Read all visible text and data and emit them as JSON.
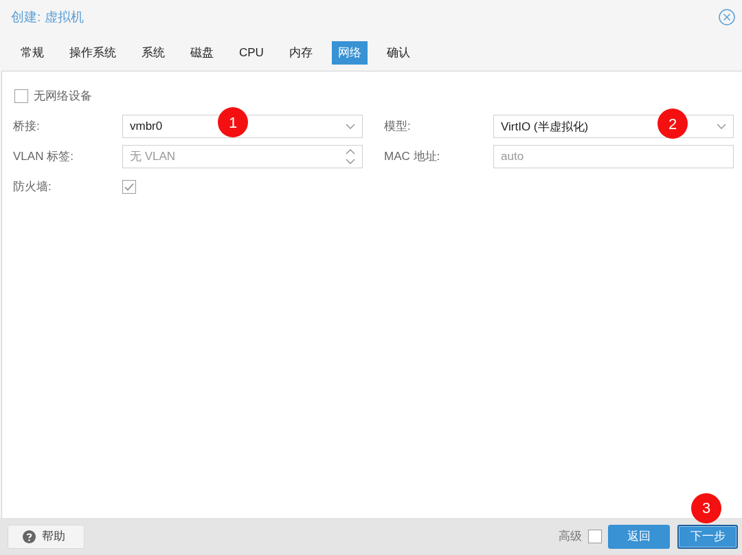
{
  "window": {
    "title": "创建: 虚拟机"
  },
  "tabs": [
    {
      "label": "常规",
      "selected": false
    },
    {
      "label": "操作系统",
      "selected": false
    },
    {
      "label": "系统",
      "selected": false
    },
    {
      "label": "磁盘",
      "selected": false
    },
    {
      "label": "CPU",
      "selected": false
    },
    {
      "label": "内存",
      "selected": false
    },
    {
      "label": "网络",
      "selected": true
    },
    {
      "label": "确认",
      "selected": false
    }
  ],
  "no_network_device": {
    "label": "无网络设备",
    "checked": false
  },
  "fields_left": [
    {
      "kind": "select",
      "label": "桥接:",
      "value": "vmbr0",
      "marker": "1"
    },
    {
      "kind": "spinner",
      "label": "VLAN 标签:",
      "placeholder": "无 VLAN"
    },
    {
      "kind": "checkbox",
      "label": "防火墙:",
      "checked": true
    }
  ],
  "fields_right": [
    {
      "kind": "select",
      "label": "模型:",
      "value": "VirtIO (半虚拟化)",
      "marker": "2"
    },
    {
      "kind": "text",
      "label": "MAC 地址:",
      "placeholder": "auto"
    }
  ],
  "footer": {
    "help_button": "帮助",
    "advanced": {
      "label": "高级",
      "checked": false
    },
    "buttons": [
      {
        "label": "返回",
        "focused": false
      },
      {
        "label": "下一步",
        "focused": true,
        "marker": "3"
      }
    ]
  }
}
